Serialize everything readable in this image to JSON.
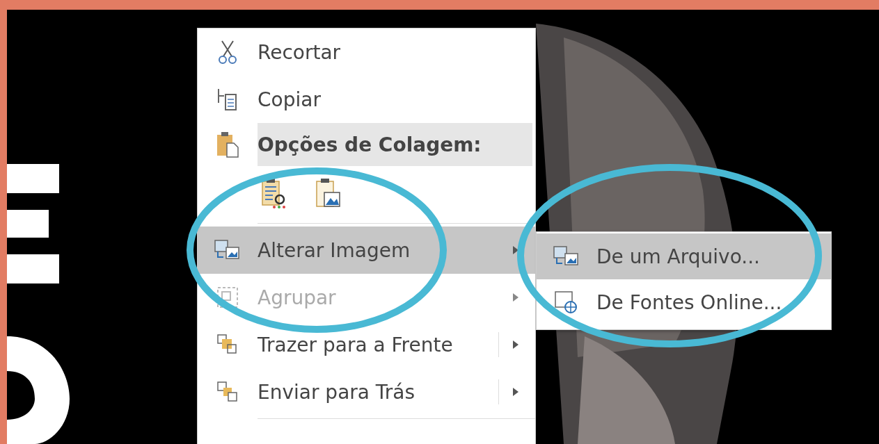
{
  "context_menu": {
    "items": [
      {
        "kind": "command",
        "label": "Recortar",
        "selected": false,
        "disabled": false,
        "submenu": false,
        "split": false
      },
      {
        "kind": "command",
        "label": "Copiar",
        "selected": false,
        "disabled": false,
        "submenu": false,
        "split": false
      },
      {
        "kind": "header",
        "label": "Opções de Colagem:"
      },
      {
        "kind": "paste_options"
      },
      {
        "kind": "separator"
      },
      {
        "kind": "command",
        "label": "Alterar Imagem",
        "selected": true,
        "disabled": false,
        "submenu": true,
        "split": false
      },
      {
        "kind": "command",
        "label": "Agrupar",
        "selected": false,
        "disabled": true,
        "submenu": true,
        "split": false
      },
      {
        "kind": "command",
        "label": "Trazer para a Frente",
        "selected": false,
        "disabled": false,
        "submenu": true,
        "split": true
      },
      {
        "kind": "command",
        "label": "Enviar para Trás",
        "selected": false,
        "disabled": false,
        "submenu": true,
        "split": true
      },
      {
        "kind": "separator"
      }
    ]
  },
  "submenu": {
    "items": [
      {
        "label": "De um Arquivo...",
        "selected": true
      },
      {
        "label": "De Fontes Online...",
        "selected": false
      }
    ]
  },
  "annotations": [
    {
      "kind": "ellipse"
    },
    {
      "kind": "ellipse"
    }
  ]
}
